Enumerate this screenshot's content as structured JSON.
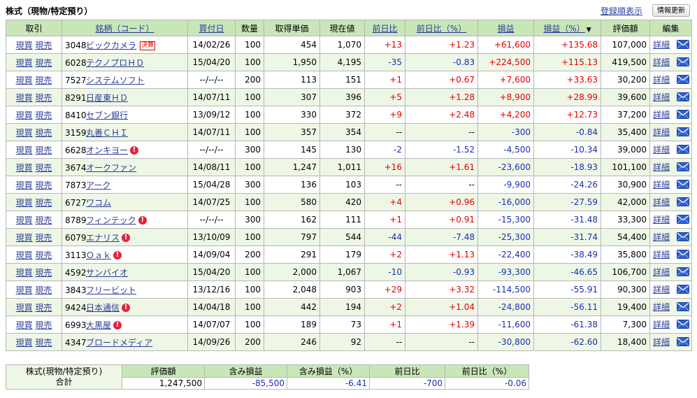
{
  "header": {
    "title": "株式（現物/特定預り）",
    "registration_order_link": "登録順表示",
    "refresh_button": "情報更新"
  },
  "columns": {
    "trade": "取引",
    "name_code": "銘柄（コード）",
    "buy_date": "買付日",
    "quantity": "数量",
    "unit_cost": "取得単価",
    "current_price": "現在値",
    "day_change": "前日比",
    "day_change_pct": "前日比（%）",
    "pnl": "損益",
    "pnl_pct": "損益（%）",
    "valuation": "評価額",
    "edit": "編集"
  },
  "trade_labels": {
    "buy": "現買",
    "sell": "現売"
  },
  "edit_labels": {
    "detail": "詳細"
  },
  "settlement_badge": "決算",
  "warning_mark": "!",
  "colors": {
    "header_bg": "#c9e6b8",
    "row_alt_bg": "#eef7e6",
    "positive": "#e00000",
    "negative": "#1a2fb0",
    "link": "#2a3d9a"
  },
  "rows": [
    {
      "code": "3048",
      "name": "ビックカメラ",
      "flag": "settle",
      "date": "14/02/26",
      "qty": "100",
      "cost": "454",
      "price": "1,070",
      "chg": "+13",
      "chg_pct": "+1.23",
      "pnl": "+61,600",
      "pnl_pct": "+135.68",
      "val": "107,000"
    },
    {
      "code": "6028",
      "name": "テクノプロＨＤ",
      "flag": "",
      "date": "15/04/20",
      "qty": "100",
      "cost": "1,950",
      "price": "4,195",
      "chg": "-35",
      "chg_pct": "-0.83",
      "pnl": "+224,500",
      "pnl_pct": "+115.13",
      "val": "419,500"
    },
    {
      "code": "7527",
      "name": "システムソフト",
      "flag": "",
      "date": "--/--/--",
      "qty": "200",
      "cost": "113",
      "price": "151",
      "chg": "+1",
      "chg_pct": "+0.67",
      "pnl": "+7,600",
      "pnl_pct": "+33.63",
      "val": "30,200"
    },
    {
      "code": "8291",
      "name": "日産東ＨＤ",
      "flag": "",
      "date": "14/07/11",
      "qty": "100",
      "cost": "307",
      "price": "396",
      "chg": "+5",
      "chg_pct": "+1.28",
      "pnl": "+8,900",
      "pnl_pct": "+28.99",
      "val": "39,600"
    },
    {
      "code": "8410",
      "name": "セブン銀行",
      "flag": "",
      "date": "13/09/12",
      "qty": "100",
      "cost": "330",
      "price": "372",
      "chg": "+9",
      "chg_pct": "+2.48",
      "pnl": "+4,200",
      "pnl_pct": "+12.73",
      "val": "37,200"
    },
    {
      "code": "3159",
      "name": "丸善ＣＨＩ",
      "flag": "",
      "date": "14/07/11",
      "qty": "100",
      "cost": "357",
      "price": "354",
      "chg": "--",
      "chg_pct": "--",
      "pnl": "-300",
      "pnl_pct": "-0.84",
      "val": "35,400"
    },
    {
      "code": "6628",
      "name": "オンキヨー",
      "flag": "warn",
      "date": "--/--/--",
      "qty": "300",
      "cost": "145",
      "price": "130",
      "chg": "-2",
      "chg_pct": "-1.52",
      "pnl": "-4,500",
      "pnl_pct": "-10.34",
      "val": "39,000"
    },
    {
      "code": "3674",
      "name": "オークファン",
      "flag": "",
      "date": "14/08/11",
      "qty": "100",
      "cost": "1,247",
      "price": "1,011",
      "chg": "+16",
      "chg_pct": "+1.61",
      "pnl": "-23,600",
      "pnl_pct": "-18.93",
      "val": "101,100"
    },
    {
      "code": "7873",
      "name": "アーク",
      "flag": "",
      "date": "15/04/28",
      "qty": "300",
      "cost": "136",
      "price": "103",
      "chg": "--",
      "chg_pct": "--",
      "pnl": "-9,900",
      "pnl_pct": "-24.26",
      "val": "30,900"
    },
    {
      "code": "6727",
      "name": "ワコム",
      "flag": "",
      "date": "14/07/25",
      "qty": "100",
      "cost": "580",
      "price": "420",
      "chg": "+4",
      "chg_pct": "+0.96",
      "pnl": "-16,000",
      "pnl_pct": "-27.59",
      "val": "42,000"
    },
    {
      "code": "8789",
      "name": "フィンテック",
      "flag": "warn",
      "date": "--/--/--",
      "qty": "300",
      "cost": "162",
      "price": "111",
      "chg": "+1",
      "chg_pct": "+0.91",
      "pnl": "-15,300",
      "pnl_pct": "-31.48",
      "val": "33,300"
    },
    {
      "code": "6079",
      "name": "エナリス",
      "flag": "warn",
      "date": "13/10/09",
      "qty": "100",
      "cost": "797",
      "price": "544",
      "chg": "-44",
      "chg_pct": "-7.48",
      "pnl": "-25,300",
      "pnl_pct": "-31.74",
      "val": "54,400"
    },
    {
      "code": "3113",
      "name": "Ｏａｋ",
      "flag": "warn",
      "date": "14/09/04",
      "qty": "200",
      "cost": "291",
      "price": "179",
      "chg": "+2",
      "chg_pct": "+1.13",
      "pnl": "-22,400",
      "pnl_pct": "-38.49",
      "val": "35,800"
    },
    {
      "code": "4592",
      "name": "サンバイオ",
      "flag": "",
      "date": "15/04/20",
      "qty": "100",
      "cost": "2,000",
      "price": "1,067",
      "chg": "-10",
      "chg_pct": "-0.93",
      "pnl": "-93,300",
      "pnl_pct": "-46.65",
      "val": "106,700"
    },
    {
      "code": "3843",
      "name": "フリービット",
      "flag": "",
      "date": "13/12/16",
      "qty": "100",
      "cost": "2,048",
      "price": "903",
      "chg": "+29",
      "chg_pct": "+3.32",
      "pnl": "-114,500",
      "pnl_pct": "-55.91",
      "val": "90,300"
    },
    {
      "code": "9424",
      "name": "日本通信",
      "flag": "warn",
      "date": "14/04/18",
      "qty": "100",
      "cost": "442",
      "price": "194",
      "chg": "+2",
      "chg_pct": "+1.04",
      "pnl": "-24,800",
      "pnl_pct": "-56.11",
      "val": "19,400"
    },
    {
      "code": "6993",
      "name": "大黒屋",
      "flag": "warn",
      "date": "14/07/07",
      "qty": "100",
      "cost": "189",
      "price": "73",
      "chg": "+1",
      "chg_pct": "+1.39",
      "pnl": "-11,600",
      "pnl_pct": "-61.38",
      "val": "7,300"
    },
    {
      "code": "4347",
      "name": "ブロードメディア",
      "flag": "",
      "date": "14/09/26",
      "qty": "200",
      "cost": "246",
      "price": "92",
      "chg": "--",
      "chg_pct": "--",
      "pnl": "-30,800",
      "pnl_pct": "-62.60",
      "val": "18,400"
    }
  ],
  "summary": {
    "label_line1": "株式(現物/特定預り)",
    "label_line2": "合計",
    "headers": {
      "valuation": "評価額",
      "unrealized": "含み損益",
      "unrealized_pct": "含み損益（%）",
      "day_change": "前日比",
      "day_change_pct": "前日比（%）"
    },
    "values": {
      "valuation": "1,247,500",
      "unrealized": "-85,500",
      "unrealized_pct": "-6.41",
      "day_change": "-700",
      "day_change_pct": "-0.06"
    }
  }
}
